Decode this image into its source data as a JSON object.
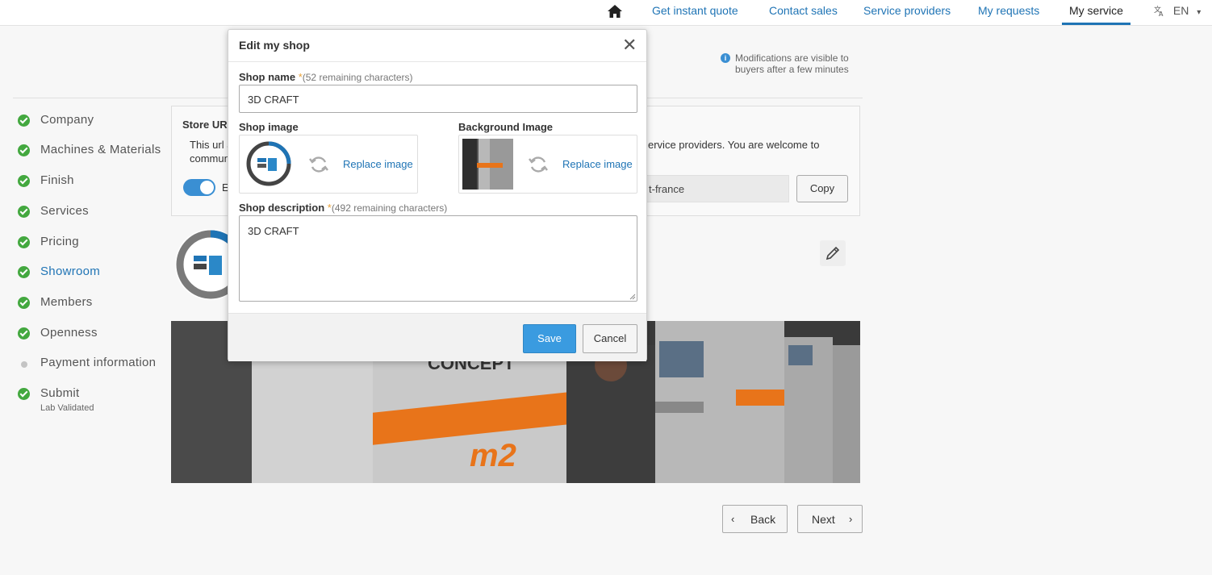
{
  "nav": {
    "home_icon": "home-icon",
    "links": [
      "Get instant quote",
      "Contact sales",
      "Service providers",
      "My requests",
      "My service"
    ],
    "active": "My service",
    "language": "EN",
    "translate_icon": "translate-icon"
  },
  "info_note": "Modifications are visible to buyers after a few minutes",
  "steps": [
    {
      "label": "Company",
      "status": "done"
    },
    {
      "label": "Machines & Materials",
      "status": "done"
    },
    {
      "label": "Finish",
      "status": "done"
    },
    {
      "label": "Services",
      "status": "done"
    },
    {
      "label": "Pricing",
      "status": "done"
    },
    {
      "label": "Showroom",
      "status": "current"
    },
    {
      "label": "Members",
      "status": "done"
    },
    {
      "label": "Openness",
      "status": "done"
    },
    {
      "label": "Payment information",
      "status": "pending"
    },
    {
      "label": "Submit",
      "status": "done",
      "sub": "Lab Validated"
    }
  ],
  "store_panel": {
    "title": "Store URL",
    "desc_line1": "This url a",
    "desc_line2": "commun",
    "desc_right": "ervice providers. You are welcome to",
    "toggle_label": "E",
    "toggle_on": true,
    "url_fragment": "t-france",
    "copy_label": "Copy"
  },
  "buttons": {
    "back": "Back",
    "next": "Next"
  },
  "modal": {
    "title": "Edit my shop",
    "shop_name_label": "Shop name",
    "required_mark": "*",
    "shop_name_hint": "(52 remaining characters)",
    "shop_name_value": "3D CRAFT",
    "shop_image_label": "Shop image",
    "background_image_label": "Background Image",
    "replace_label": "Replace image",
    "description_label": "Shop description",
    "description_hint": "(492 remaining characters)",
    "description_value": "3D CRAFT",
    "save_label": "Save",
    "cancel_label": "Cancel"
  },
  "colors": {
    "accent": "#1f74b5",
    "primary_button": "#3a9be0",
    "success": "#43a83f",
    "required": "#e8a23a"
  }
}
